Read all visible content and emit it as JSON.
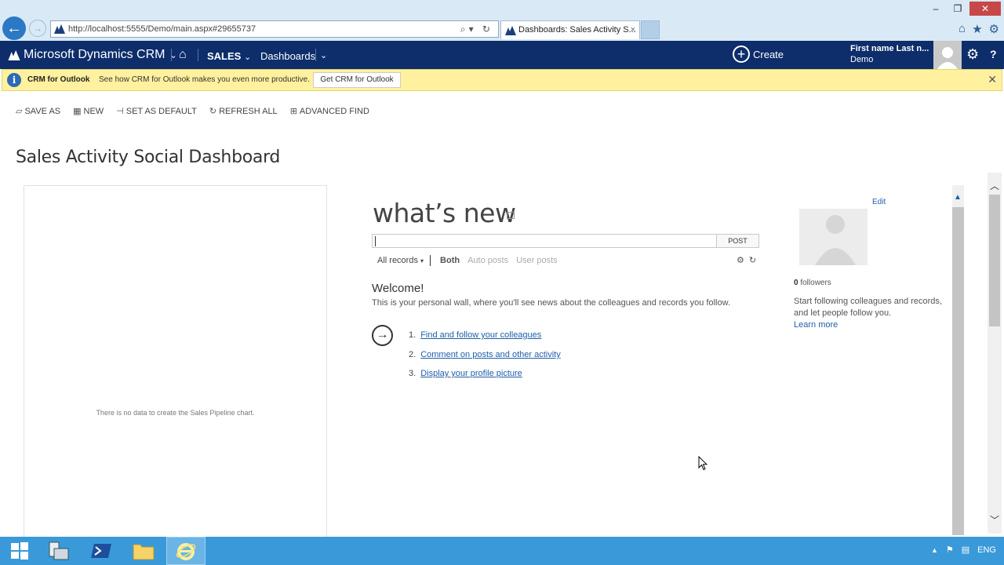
{
  "browser": {
    "url": "http://localhost:5555/Demo/main.aspx#29655737",
    "tab_title": "Dashboards: Sales Activity S...",
    "tab_close": "×",
    "window_controls": [
      "–",
      "❐",
      "✕"
    ],
    "icons": [
      "back-icon",
      "forward-icon",
      "search-icon",
      "refresh-icon",
      "home-icon",
      "favorites-icon",
      "tools-icon"
    ]
  },
  "nav": {
    "brand": "Microsoft Dynamics CRM",
    "area": "SALES",
    "section": "Dashboards",
    "create_label": "Create",
    "user_name": "First name Last n...",
    "user_org": "Demo",
    "help": "?"
  },
  "notification": {
    "title": "CRM for Outlook",
    "message": "See how CRM for Outlook makes you even more productive.",
    "button": "Get CRM for Outlook",
    "close": "✕"
  },
  "commands": [
    {
      "label": "SAVE AS",
      "icon": "save-as-icon"
    },
    {
      "label": "NEW",
      "icon": "new-icon"
    },
    {
      "label": "SET AS DEFAULT",
      "icon": "pin-icon"
    },
    {
      "label": "REFRESH ALL",
      "icon": "refresh-icon"
    },
    {
      "label": "ADVANCED FIND",
      "icon": "binoculars-icon"
    }
  ],
  "dashboard": {
    "title": "Sales Activity Social Dashboard",
    "chart_empty": "There is no data to create the Sales Pipeline chart."
  },
  "wall": {
    "title": "what’s new",
    "post_button": "POST",
    "post_value": "",
    "filter_all": "All records",
    "filter_both": "Both",
    "filter_auto": "Auto posts",
    "filter_user": "User posts",
    "welcome_title": "Welcome!",
    "welcome_sub": "This is your personal wall, where you'll see news about the colleagues and records you follow.",
    "steps": [
      {
        "num": "1.",
        "label": "Find and follow your colleagues"
      },
      {
        "num": "2.",
        "label": "Comment on posts and other activity"
      },
      {
        "num": "3.",
        "label": "Display your profile picture"
      }
    ]
  },
  "profile": {
    "edit": "Edit",
    "followers_count": "0",
    "followers_label": "followers",
    "follow_text": "Start following colleagues and records, and let people follow you.",
    "learn_more": "Learn more"
  },
  "taskbar": {
    "items": [
      "start-button",
      "server-manager",
      "powershell",
      "file-explorer",
      "internet-explorer"
    ],
    "language": "ENG"
  }
}
